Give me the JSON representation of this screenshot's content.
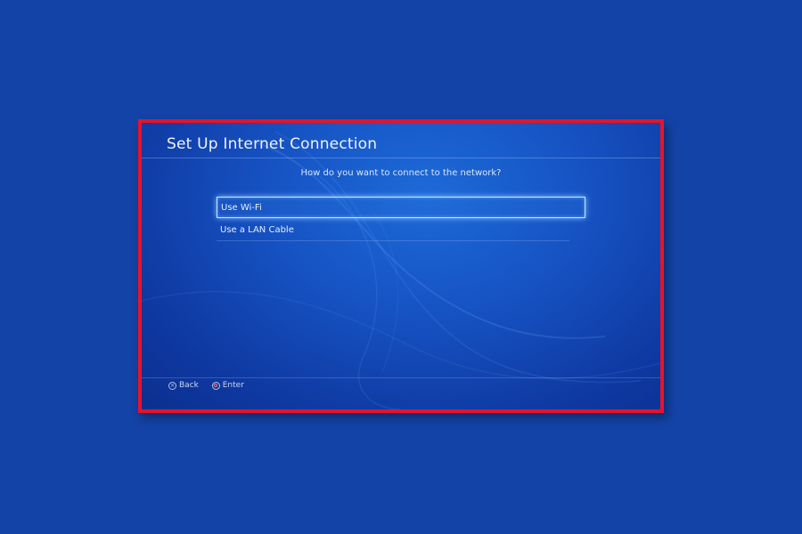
{
  "dialog": {
    "title": "Set Up Internet Connection",
    "prompt": "How do you want to connect to the network?",
    "options": [
      {
        "label": "Use Wi-Fi",
        "selected": true
      },
      {
        "label": "Use a LAN Cable",
        "selected": false
      }
    ]
  },
  "footer": {
    "back": {
      "icon": "cross-button-icon",
      "label": "Back"
    },
    "enter": {
      "icon": "circle-button-icon",
      "label": "Enter"
    }
  },
  "colors": {
    "page_background": "#1343a6",
    "highlight_border": "#e8122d",
    "panel_background": "#1652c2",
    "selection_glow": "#bfe3ff"
  }
}
